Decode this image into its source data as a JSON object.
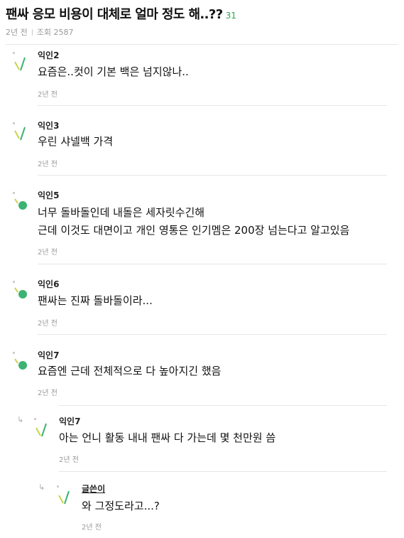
{
  "post": {
    "title": "팬싸 응모 비용이 대체로 얼마 정도 해..??",
    "comment_count": "31",
    "time": "2년 전",
    "views": "조회 2587"
  },
  "comments": [
    {
      "author": "익인2",
      "lines": [
        "요즘은..컷이 기본 백은 넘지않나.."
      ],
      "time": "2년 전"
    },
    {
      "author": "익인3",
      "lines": [
        "우린 샤넬백 가격"
      ],
      "time": "2년 전"
    },
    {
      "author": "익인5",
      "lines": [
        "너무 돌바돌인데 내돌은 세자릿수긴해",
        "근데 이것도 대면이고 개인 영통은 인기멤은 200장 넘는다고 알고있음"
      ],
      "time": "2년 전"
    },
    {
      "author": "익인6",
      "lines": [
        "팬싸는 진짜 돌바돌이라..."
      ],
      "time": "2년 전"
    },
    {
      "author": "익인7",
      "lines": [
        "요즘엔 근데 전체적으로 다 높아지긴 했음"
      ],
      "time": "2년 전"
    },
    {
      "author": "익인7",
      "lines": [
        "아는 언니 활동 내내 팬싸 다 가는데 몇 천만원 씀"
      ],
      "time": "2년 전"
    },
    {
      "author": "글쓴이",
      "lines": [
        "와 그정도라고...?"
      ],
      "time": "2년 전"
    }
  ],
  "icons": {
    "avatar": "stick-avatar-icon",
    "reply": "reply-arrow-icon"
  },
  "colors": {
    "accent_green": "#2ea44f",
    "avatar_green": "#3cb371",
    "avatar_yellow": "#c8d44a"
  }
}
